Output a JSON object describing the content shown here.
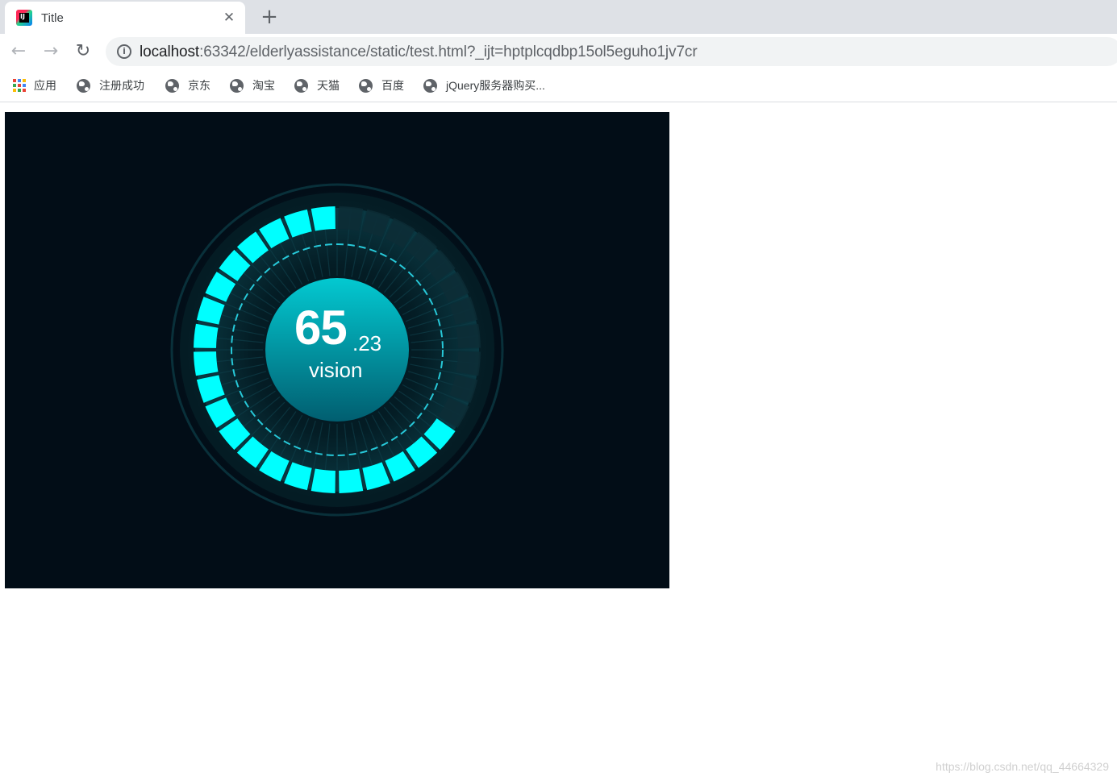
{
  "browser": {
    "tab": {
      "title": "Title",
      "favicon_icon": "intellij-icon"
    },
    "address": {
      "host": "localhost",
      "path": ":63342/elderlyassistance/static/test.html?_ijt=hptplcqdbp15ol5eguho1jv7cr"
    },
    "bookmarks": [
      {
        "label": "应用",
        "icon": "apps-grid-icon"
      },
      {
        "label": "注册成功",
        "icon": "globe-icon"
      },
      {
        "label": "京东",
        "icon": "globe-icon"
      },
      {
        "label": "淘宝",
        "icon": "globe-icon"
      },
      {
        "label": "天猫",
        "icon": "globe-icon"
      },
      {
        "label": "百度",
        "icon": "globe-icon"
      },
      {
        "label": "jQuery服务器购买...",
        "icon": "globe-icon"
      }
    ]
  },
  "gauge": {
    "value_main": "65",
    "value_decimal": ".23",
    "label": "vision",
    "value": 65.23,
    "max": 100,
    "segments": 32,
    "colors": {
      "background": "#020d17",
      "active": "#00ffff",
      "inactive": "#0d2d36",
      "dashed_ring": "#27c8d8",
      "center_top": "#03c9d1",
      "center_bottom": "#015e70"
    }
  },
  "watermark": "https://blog.csdn.net/qq_44664329"
}
